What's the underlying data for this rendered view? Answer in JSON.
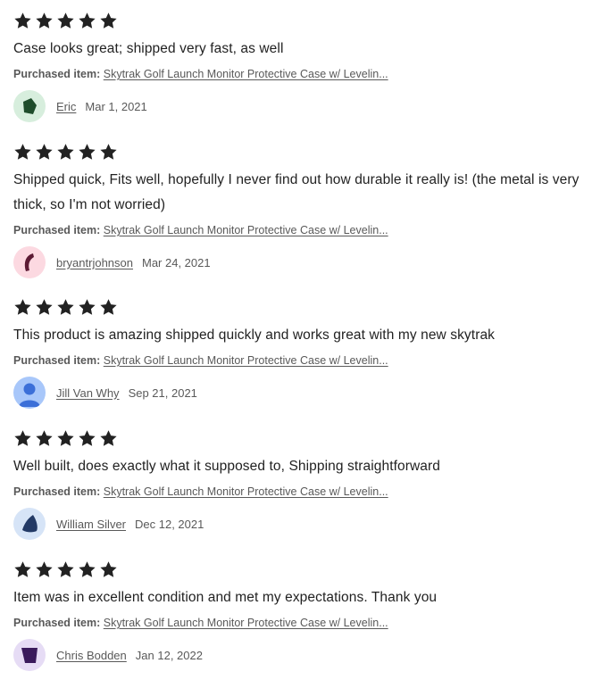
{
  "reviews": [
    {
      "rating": 5,
      "text": "Case looks great; shipped very fast, as well",
      "purchased_label": "Purchased item:",
      "purchased_item": "Skytrak Golf Launch Monitor Protective Case w/ Levelin...",
      "reviewer": "Eric",
      "date": "Mar 1, 2021",
      "avatar_icon": "green-pentagon-avatar",
      "avatar_bg": "#d7eedd",
      "avatar_fg": "#1e4d2b"
    },
    {
      "rating": 5,
      "text": "Shipped quick, Fits well, hopefully I never find out how durable it really is! (the metal is very thick, so I'm not worried)",
      "purchased_label": "Purchased item:",
      "purchased_item": "Skytrak Golf Launch Monitor Protective Case w/ Levelin...",
      "reviewer": "bryantrjohnson",
      "date": "Mar 24, 2021",
      "avatar_icon": "maroon-arc-avatar",
      "avatar_bg": "#fcd9e1",
      "avatar_fg": "#5c1a33"
    },
    {
      "rating": 5,
      "text": "This product is amazing shipped quickly and works great with my new skytrak",
      "purchased_label": "Purchased item:",
      "purchased_item": "Skytrak Golf Launch Monitor Protective Case w/ Levelin...",
      "reviewer": "Jill Van Why",
      "date": "Sep 21, 2021",
      "avatar_icon": "default-person-avatar",
      "avatar_bg": "#a8c7fa",
      "avatar_fg": "#3b6fd8"
    },
    {
      "rating": 5,
      "text": "Well built, does exactly what it supposed to, Shipping straightforward",
      "purchased_label": "Purchased item:",
      "purchased_item": "Skytrak Golf Launch Monitor Protective Case w/ Levelin...",
      "reviewer": "William Silver",
      "date": "Dec 12, 2021",
      "avatar_icon": "navy-drop-avatar",
      "avatar_bg": "#d6e4f7",
      "avatar_fg": "#233a66"
    },
    {
      "rating": 5,
      "text": "Item was in excellent condition and met my expectations. Thank you",
      "purchased_label": "Purchased item:",
      "purchased_item": "Skytrak Golf Launch Monitor Protective Case w/ Levelin...",
      "reviewer": "Chris Bodden",
      "date": "Jan 12, 2022",
      "avatar_icon": "purple-cup-avatar",
      "avatar_bg": "#e6dcf5",
      "avatar_fg": "#3a1a5c"
    }
  ]
}
